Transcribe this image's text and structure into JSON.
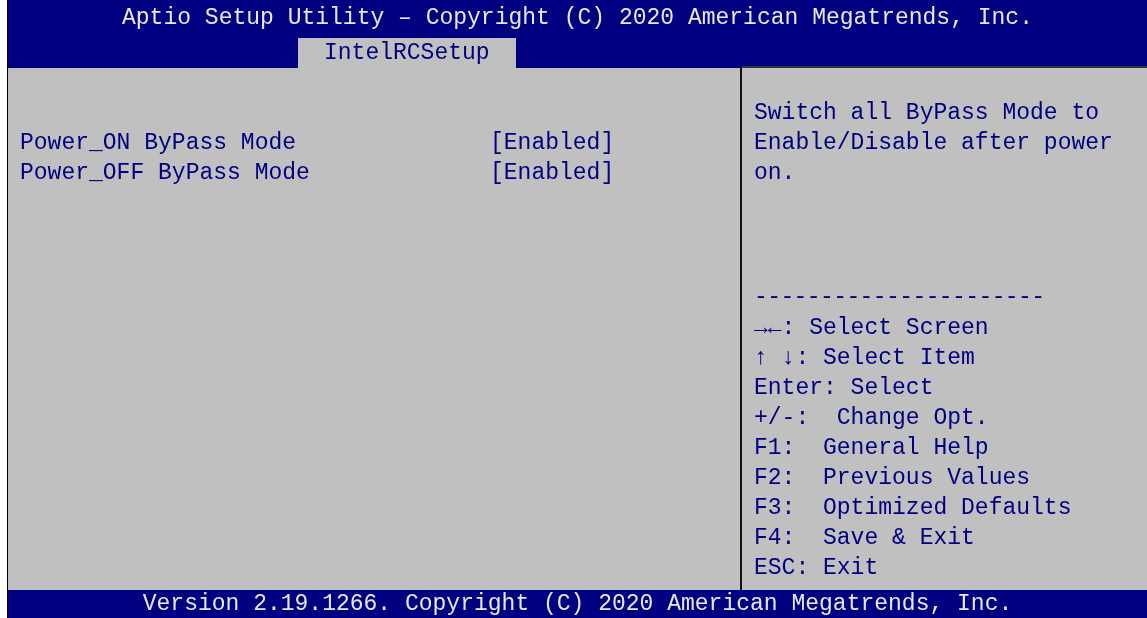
{
  "title": "Aptio Setup Utility – Copyright (C) 2020 American Megatrends, Inc.",
  "tabs": [
    {
      "label": "IntelRCSetup",
      "selected": true
    }
  ],
  "settings": [
    {
      "label": "Power_ON ByPass Mode",
      "value": "[Enabled]"
    },
    {
      "label": "Power_OFF ByPass Mode",
      "value": "[Enabled]"
    }
  ],
  "help_text": "Switch all ByPass Mode to Enable/Disable after power on.",
  "separator": "----------------------",
  "key_help": [
    "→←: Select Screen",
    "↑ ↓: Select Item",
    "Enter: Select",
    "+/-:  Change Opt.",
    "F1:  General Help",
    "F2:  Previous Values",
    "F3:  Optimized Defaults",
    "F4:  Save & Exit",
    "ESC: Exit"
  ],
  "status_bar": "Version 2.19.1266. Copyright (C) 2020 American Megatrends, Inc."
}
